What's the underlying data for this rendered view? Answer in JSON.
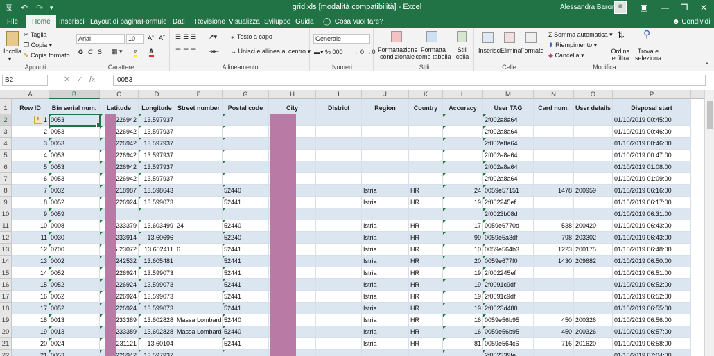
{
  "window": {
    "title": "grid.xls  [modalità compatibilità]  -  Excel",
    "user": "Alessandra Baron",
    "quick_access": [
      "save-icon",
      "undo-icon",
      "redo-icon",
      "customize-icon"
    ],
    "controls": [
      "ribbon-display-icon",
      "minimize-icon",
      "restore-icon",
      "close-icon"
    ]
  },
  "tabs": [
    "File",
    "Home",
    "Inserisci",
    "Layout di pagina",
    "Formule",
    "Dati",
    "Revisione",
    "Visualizza",
    "Sviluppo",
    "Guida"
  ],
  "active_tab": "Home",
  "tell_me": "Cosa vuoi fare?",
  "share": "Condividi",
  "ribbon": {
    "clipboard": {
      "label": "Appunti",
      "paste": "Incolla",
      "cut": "Taglia",
      "copy": "Copia",
      "format_painter": "Copia formato"
    },
    "font": {
      "label": "Carattere",
      "font_name": "Arial",
      "font_size": "10",
      "bold": "G",
      "italic": "C",
      "underline": "S"
    },
    "alignment": {
      "label": "Allineamento",
      "wrap": "Testo a capo",
      "merge": "Unisci e allinea al centro"
    },
    "number": {
      "label": "Numeri",
      "format": "Generale"
    },
    "styles": {
      "label": "Stili",
      "conditional": "Formattazione condizionale",
      "table": "Formatta come tabella",
      "cell_styles": "Stili cella"
    },
    "cells": {
      "label": "Celle",
      "insert": "Inserisci",
      "delete": "Elimina",
      "format": "Formato"
    },
    "editing": {
      "label": "Modifica",
      "autosum": "Somma automatica",
      "fill": "Riempimento",
      "clear": "Cancella",
      "sort": "Ordina e filtra",
      "find": "Trova e seleziona"
    }
  },
  "formula_bar": {
    "name_box": "B2",
    "value": "0053"
  },
  "columns": [
    "A",
    "B",
    "C",
    "D",
    "F",
    "G",
    "H",
    "I",
    "J",
    "K",
    "L",
    "M",
    "N",
    "O",
    "P"
  ],
  "selected_column": "B",
  "selected_row": "2",
  "headers": [
    "Row ID",
    "Bin serial num.",
    "Latitude",
    "Longitude",
    "Street number",
    "Postal code",
    "City",
    "District",
    "Region",
    "Country",
    "Accuracy",
    "User TAG",
    "Card num.",
    "User details",
    "Disposal start"
  ],
  "rows": [
    {
      "n": "2",
      "cells": [
        "1",
        "0053",
        "226942",
        "13.597937",
        "",
        "",
        "",
        "",
        "",
        "",
        "",
        "2f002a8a64",
        "",
        "",
        "01/10/2019 00:45:00"
      ]
    },
    {
      "n": "3",
      "cells": [
        "2",
        "0053",
        "226942",
        "13.597937",
        "",
        "",
        "",
        "",
        "",
        "",
        "",
        "2f002a8a64",
        "",
        "",
        "01/10/2019 00:46:00"
      ]
    },
    {
      "n": "4",
      "cells": [
        "3",
        "0053",
        "226942",
        "13.597937",
        "",
        "",
        "",
        "",
        "",
        "",
        "",
        "2f002a8a64",
        "",
        "",
        "01/10/2019 00:46:00"
      ]
    },
    {
      "n": "5",
      "cells": [
        "4",
        "0053",
        "226942",
        "13.597937",
        "",
        "",
        "",
        "",
        "",
        "",
        "",
        "2f002a8a64",
        "",
        "",
        "01/10/2019 00:47:00"
      ]
    },
    {
      "n": "6",
      "cells": [
        "5",
        "0053",
        "226942",
        "13.597937",
        "",
        "",
        "",
        "",
        "",
        "",
        "",
        "2f002a8a64",
        "",
        "",
        "01/10/2019 01:08:00"
      ]
    },
    {
      "n": "7",
      "cells": [
        "6",
        "0053",
        "226942",
        "13.597937",
        "",
        "",
        "",
        "",
        "",
        "",
        "",
        "2f002a8a64",
        "",
        "",
        "01/10/2019 01:09:00"
      ]
    },
    {
      "n": "8",
      "cells": [
        "7",
        "0032",
        "218987",
        "13.598643",
        "",
        "52440",
        "",
        "",
        "Istria",
        "HR",
        "24",
        "0059e57151",
        "1478",
        "200959",
        "01/10/2019 06:16:00"
      ]
    },
    {
      "n": "9",
      "cells": [
        "8",
        "0052",
        "226924",
        "13.599073",
        "",
        "52441",
        "",
        "",
        "Istria",
        "HR",
        "19",
        "2f002245ef",
        "",
        "",
        "01/10/2019 06:17:00"
      ]
    },
    {
      "n": "10",
      "cells": [
        "9",
        "0059",
        "",
        "",
        "",
        "",
        "",
        "",
        "",
        "",
        "",
        "2f0023b08d",
        "",
        "",
        "01/10/2019 06:31:00"
      ]
    },
    {
      "n": "11",
      "cells": [
        "10",
        "0008",
        "233379",
        "13.603499",
        "24",
        "52440",
        "",
        "",
        "Istria",
        "HR",
        "17",
        "0059e6770d",
        "538",
        "200420",
        "01/10/2019 06:43:00"
      ]
    },
    {
      "n": "12",
      "cells": [
        "11",
        "0030",
        "233914",
        "13.60696",
        "",
        "52240",
        "",
        "",
        "Istria",
        "HR",
        "99",
        "0059e5a3df",
        "798",
        "203302",
        "01/10/2019 06:43:00"
      ]
    },
    {
      "n": "13",
      "cells": [
        "12",
        "0700",
        "5.23072",
        "13.602411",
        "6",
        "52441",
        "",
        "",
        "Istria",
        "HR",
        "10",
        "0059e564b3",
        "1223",
        "200175",
        "01/10/2019 06:48:00"
      ]
    },
    {
      "n": "14",
      "cells": [
        "13",
        "0002",
        "242532",
        "13.605481",
        "",
        "52441",
        "",
        "",
        "Istria",
        "HR",
        "20",
        "0059e677f0",
        "1430",
        "209682",
        "01/10/2019 06:50:00"
      ]
    },
    {
      "n": "15",
      "cells": [
        "14",
        "0052",
        "226924",
        "13.599073",
        "",
        "52441",
        "",
        "",
        "Istria",
        "HR",
        "19",
        "2f002245ef",
        "",
        "",
        "01/10/2019 06:51:00"
      ]
    },
    {
      "n": "16",
      "cells": [
        "15",
        "0052",
        "226924",
        "13.599073",
        "",
        "52441",
        "",
        "",
        "Istria",
        "HR",
        "19",
        "2f0091c9df",
        "",
        "",
        "01/10/2019 06:52:00"
      ]
    },
    {
      "n": "17",
      "cells": [
        "16",
        "0052",
        "226924",
        "13.599073",
        "",
        "52441",
        "",
        "",
        "Istria",
        "HR",
        "19",
        "2f0091c9df",
        "",
        "",
        "01/10/2019 06:52:00"
      ]
    },
    {
      "n": "18",
      "cells": [
        "17",
        "0052",
        "226924",
        "13.599073",
        "",
        "52441",
        "",
        "",
        "Istria",
        "HR",
        "19",
        "2f0023d480",
        "",
        "",
        "01/10/2019 06:55:00"
      ]
    },
    {
      "n": "19",
      "cells": [
        "18",
        "0013",
        "233389",
        "13.602828",
        "Massa Lombarda",
        "52440",
        "",
        "",
        "Istria",
        "HR",
        "16",
        "0059e56b95",
        "450",
        "200326",
        "01/10/2019 06:56:00"
      ]
    },
    {
      "n": "20",
      "cells": [
        "19",
        "0013",
        "233389",
        "13.602828",
        "Massa Lombarda",
        "52440",
        "",
        "",
        "Istria",
        "HR",
        "16",
        "0059e56b95",
        "450",
        "200326",
        "01/10/2019 06:57:00"
      ]
    },
    {
      "n": "21",
      "cells": [
        "20",
        "0024",
        "231121",
        "13.60104",
        "",
        "52441",
        "",
        "",
        "Istria",
        "HR",
        "81",
        "0059e564c6",
        "716",
        "201620",
        "01/10/2019 06:58:00"
      ]
    },
    {
      "n": "22",
      "cells": [
        "21",
        "0053",
        "226942",
        "13.597937",
        "",
        "",
        "",
        "",
        "",
        "",
        "",
        "2f002339fe",
        "",
        "",
        "01/10/2019 07:04:00"
      ]
    }
  ],
  "colors": {
    "accent": "#217346",
    "header_band": "#dce6f1",
    "redaction": "#b97ba6"
  }
}
